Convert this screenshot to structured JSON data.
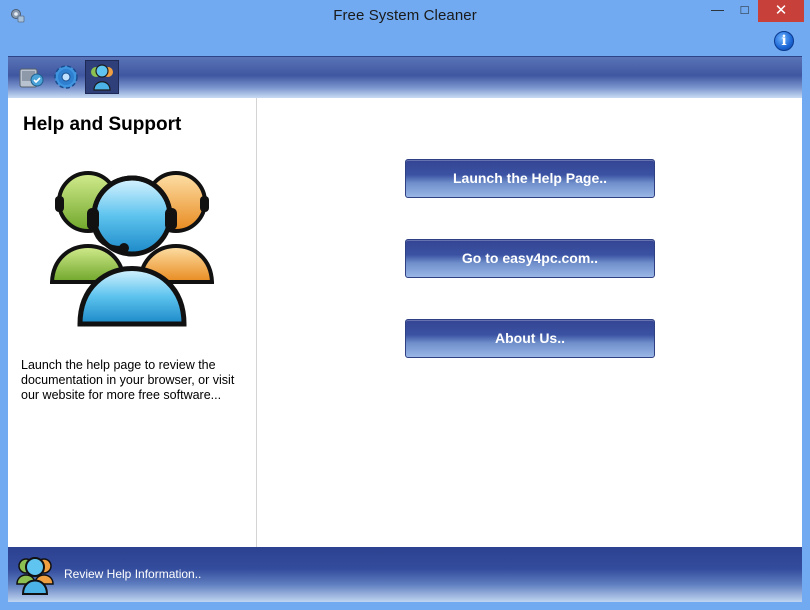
{
  "window": {
    "title": "Free System Cleaner",
    "minimize_glyph": "—",
    "maximize_glyph": "□",
    "close_glyph": "✕"
  },
  "info": {
    "glyph": "i"
  },
  "toolbar": {
    "items": [
      {
        "name": "cleaner",
        "icon": "drive-cleaner-icon"
      },
      {
        "name": "settings",
        "icon": "gear-icon"
      },
      {
        "name": "help",
        "icon": "support-people-icon",
        "active": true
      }
    ]
  },
  "left_panel": {
    "title": "Help and Support",
    "description": "Launch the help page to review the documentation in your browser, or visit our website for more free software..."
  },
  "actions": {
    "launch_help": "Launch the Help Page..",
    "goto_site": "Go to easy4pc.com..",
    "about": "About Us.."
  },
  "status": {
    "text": "Review Help Information.."
  },
  "colors": {
    "window_frame": "#71aaf0",
    "close_button": "#c7413a",
    "toolbar_dark": "#3f57a0",
    "button_dark": "#344494",
    "button_light": "#9ab6e6"
  }
}
